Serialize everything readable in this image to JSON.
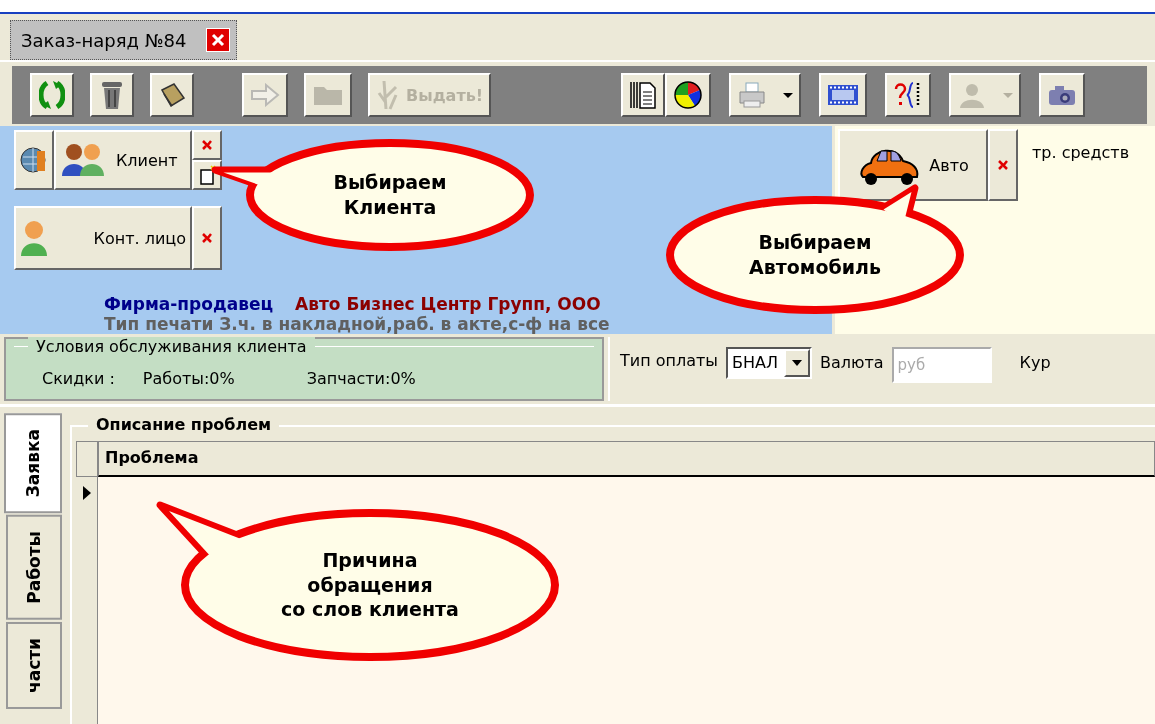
{
  "document_tab": {
    "title": "Заказ-наряд №84",
    "selected": true
  },
  "toolbar": {
    "left": [
      [
        {
          "kind": "refresh",
          "disabled": false
        },
        {
          "kind": "delete",
          "disabled": false
        },
        {
          "kind": "book",
          "disabled": false
        }
      ],
      [
        {
          "kind": "arrow",
          "disabled": true
        },
        {
          "kind": "folder",
          "disabled": true
        },
        {
          "kind": "issue",
          "label": "Выдать!",
          "disabled": true
        }
      ]
    ],
    "right": [
      [
        {
          "kind": "pages",
          "disabled": false
        },
        {
          "kind": "pie",
          "disabled": false
        }
      ],
      [
        {
          "kind": "print",
          "disabled": false,
          "dropdown": true
        }
      ],
      [
        {
          "kind": "film",
          "disabled": false
        }
      ],
      [
        {
          "kind": "code",
          "disabled": false
        }
      ],
      [
        {
          "kind": "user",
          "disabled": true,
          "dropdown": true
        }
      ],
      [
        {
          "kind": "camera",
          "disabled": false
        }
      ]
    ]
  },
  "client_panel": {
    "client_button": "Клиент",
    "contact_button": "Конт. лицо",
    "seller_label": "Фирма-продавец",
    "seller_value": "Авто Бизнес Центр Групп, ООО",
    "print_type": "Тип печати З.ч. в накладной,раб. в акте,с-ф на все"
  },
  "vehicle_panel": {
    "auto_button": "Авто",
    "vehicle_label": "тр. средств"
  },
  "service_terms": {
    "legend": "Условия обслуживания клиента",
    "discounts_label": "Скидки :",
    "works": "Работы:0%",
    "parts": "Запчасти:0%"
  },
  "payment": {
    "type_label": "Тип оплаты",
    "type_value": "БНАЛ",
    "currency_label": "Валюта",
    "currency_value": "руб",
    "rate_label": "Кур"
  },
  "side_tabs": [
    {
      "label": "Заявка",
      "selected": true
    },
    {
      "label": "Работы",
      "selected": false
    },
    {
      "label": "части",
      "selected": false
    }
  ],
  "problems": {
    "legend": "Описание проблем",
    "column": "Проблема"
  },
  "callouts": [
    {
      "lines": [
        "Выбираем",
        "Клиента"
      ]
    },
    {
      "lines": [
        "Выбираем",
        "Автомобиль"
      ]
    },
    {
      "lines": [
        "Причина",
        "обращения",
        "со слов клиента"
      ]
    }
  ]
}
